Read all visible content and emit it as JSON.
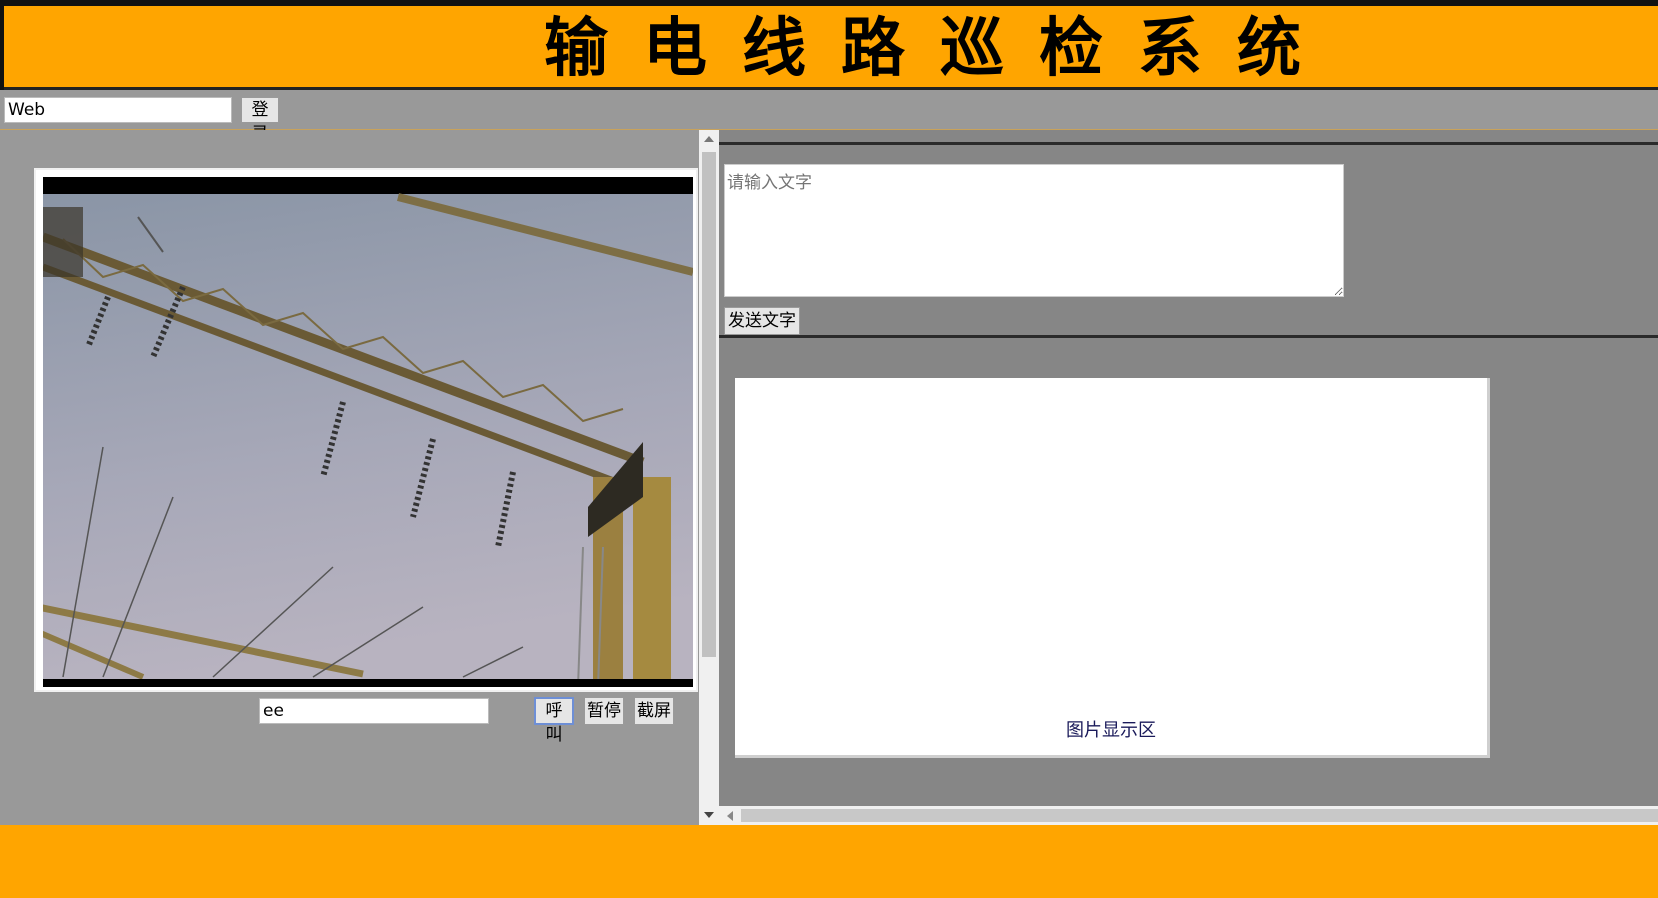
{
  "header": {
    "title": "输电线路巡检系统"
  },
  "login": {
    "url_value": "Web",
    "login_label": "登录"
  },
  "video": {
    "call_input_value": "ee",
    "call_label": "呼叫",
    "pause_label": "暂停",
    "screenshot_label": "截屏"
  },
  "message": {
    "placeholder": "请输入文字",
    "send_label": "发送文字"
  },
  "image_area": {
    "caption": "图片显示区"
  },
  "colors": {
    "accent": "#FFA500",
    "panel_left": "#999999",
    "panel_right": "#868686"
  }
}
